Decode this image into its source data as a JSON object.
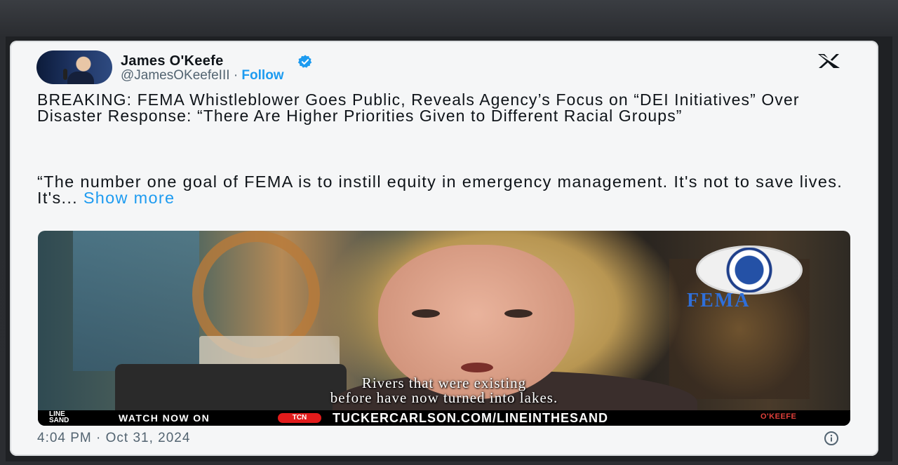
{
  "tweet": {
    "author_name": "James O'Keefe",
    "handle": "@JamesOKeefeIII",
    "separator": "·",
    "follow_label": "Follow",
    "headline": "BREAKING: FEMA Whistleblower Goes Public, Reveals Agency’s Focus on “DEI Initiatives” Over Disaster Response: “There Are Higher Priorities Given to Different Racial Groups”",
    "body": "“The number one goal of FEMA is to instill equity in emergency management. It's not to save lives. It's...",
    "show_more_label": "Show more",
    "timestamp": "4:04 PM · Oct 31, 2024"
  },
  "media": {
    "watermark": "FEMA",
    "subtitle_line1": "Rivers that were existing",
    "subtitle_line2": "before have now turned into lakes.",
    "ticker": {
      "line1": "LINE",
      "line2": "SAND",
      "watch": "WATCH NOW ON",
      "network": "TCN",
      "url": "TUCKERCARLSON.COM/LINEINTHESAND",
      "brand": "O'KEEFE"
    }
  },
  "icons": {
    "verified": "verified-badge-icon",
    "x_logo": "x-logo-icon",
    "info": "info-icon",
    "seal": "dhs-seal-icon"
  },
  "colors": {
    "link": "#1d9bf0",
    "text": "#0f1419",
    "muted": "#536471",
    "ticker_red": "#e21b1b"
  }
}
